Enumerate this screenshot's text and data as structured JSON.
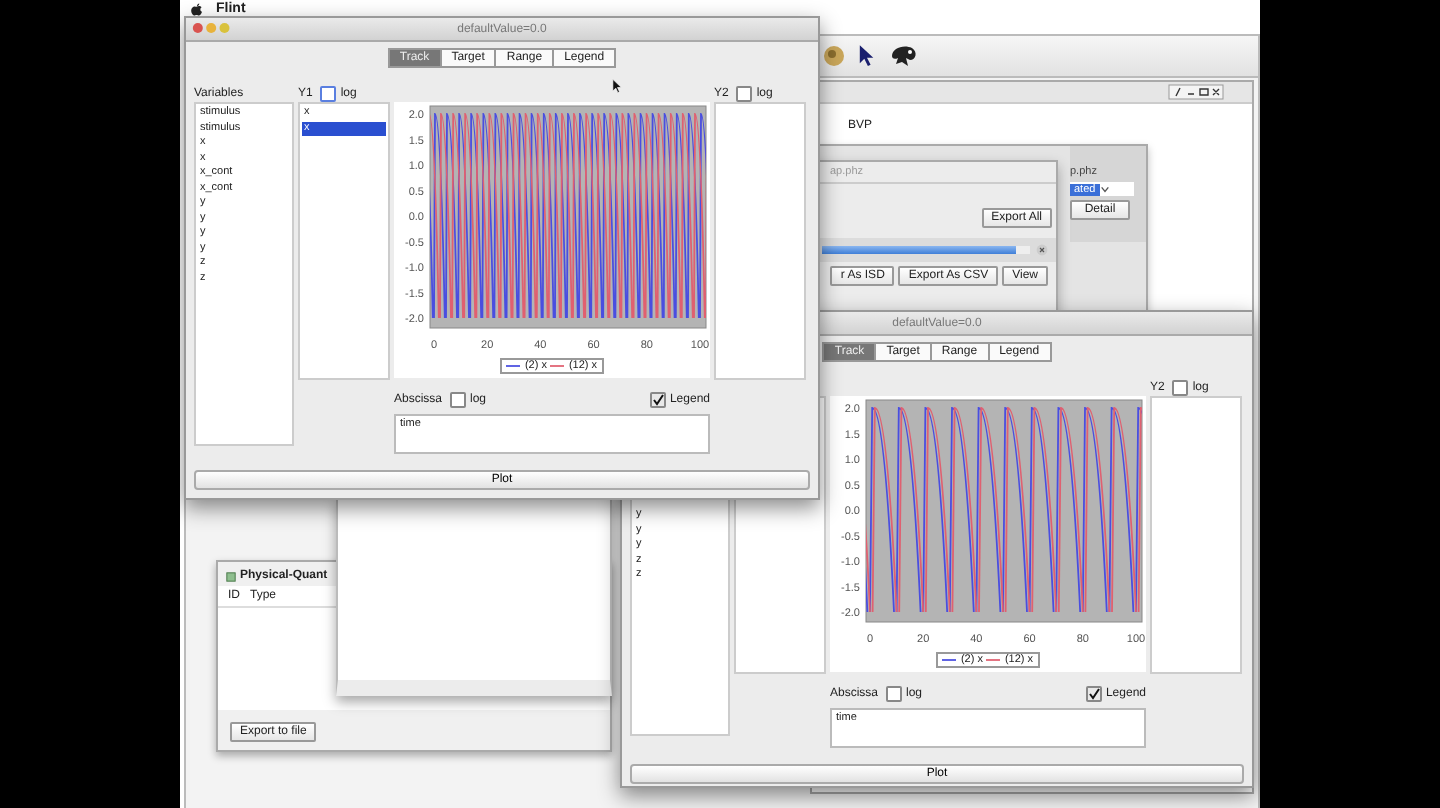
{
  "menu_bar": {
    "app": "Flint"
  },
  "background": {
    "project_window": {
      "label": "BVP"
    },
    "file_window": {
      "title": "p.phz",
      "dropdown": "ated",
      "detail_button": "Detail"
    },
    "export_window": {
      "title": "ap.phz",
      "export_all_button": "Export All",
      "progress": {
        "level": 0.93
      },
      "buttons": [
        "r As ISD",
        "Export As CSV",
        "View"
      ]
    },
    "quantity_panel": {
      "title": "Physical-Quant",
      "columns": [
        "ID",
        "Type"
      ],
      "export_button": "Export to file"
    }
  },
  "plot_windows": [
    {
      "title": "defaultValue=0.0",
      "tabs": [
        {
          "label": "Track",
          "selected": true
        },
        {
          "label": "Target",
          "selected": false
        },
        {
          "label": "Range",
          "selected": false
        },
        {
          "label": "Legend",
          "selected": false
        }
      ],
      "variables_label": "Variables",
      "variables": [
        "stimulus",
        "stimulus",
        "x",
        "x",
        "x_cont",
        "x_cont",
        "y",
        "y",
        "y",
        "y",
        "z",
        "z"
      ],
      "y1_label": "Y1",
      "y1_log": {
        "label": "log",
        "checked": false
      },
      "y1_items": [
        {
          "label": "x",
          "selected": false
        },
        {
          "label": "x",
          "selected": true
        }
      ],
      "y2_label": "Y2",
      "y2_log": {
        "label": "log",
        "checked": false
      },
      "chart": {
        "y_ticks": [
          "2.0",
          "1.5",
          "1.0",
          "0.5",
          "0.0",
          "-0.5",
          "-1.0",
          "-1.5",
          "-2.0"
        ],
        "x_ticks": [
          "0",
          "20",
          "40",
          "60",
          "80",
          "100"
        ]
      },
      "legend": [
        {
          "label": "(2) x",
          "color": "#4a4ee0"
        },
        {
          "label": "(12) x",
          "color": "#e06070"
        }
      ],
      "abscissa_label": "Abscissa",
      "abscissa_log": {
        "label": "log",
        "checked": false
      },
      "legend_toggle": {
        "label": "Legend",
        "checked": true
      },
      "abscissa_field": "time",
      "plot_button": "Plot"
    },
    {
      "title": "defaultValue=0.0",
      "tabs": [
        {
          "label": "Track",
          "selected": true
        },
        {
          "label": "Target",
          "selected": false
        },
        {
          "label": "Range",
          "selected": false
        },
        {
          "label": "Legend",
          "selected": false
        }
      ],
      "variables": [
        "y",
        "y",
        "y",
        "z",
        "z"
      ],
      "y2_label": "Y2",
      "y2_log": {
        "label": "log",
        "checked": false
      },
      "chart": {
        "y_ticks": [
          "2.0",
          "1.5",
          "1.0",
          "0.5",
          "0.0",
          "-0.5",
          "-1.0",
          "-1.5",
          "-2.0"
        ],
        "x_ticks": [
          "0",
          "20",
          "40",
          "60",
          "80",
          "100"
        ]
      },
      "legend": [
        {
          "label": "(2) x",
          "color": "#4a4ee0"
        },
        {
          "label": "(12) x",
          "color": "#e06070"
        }
      ],
      "abscissa_label": "Abscissa",
      "abscissa_log": {
        "label": "log",
        "checked": false
      },
      "legend_toggle": {
        "label": "Legend",
        "checked": true
      },
      "abscissa_field": "time",
      "plot_button": "Plot"
    }
  ]
}
